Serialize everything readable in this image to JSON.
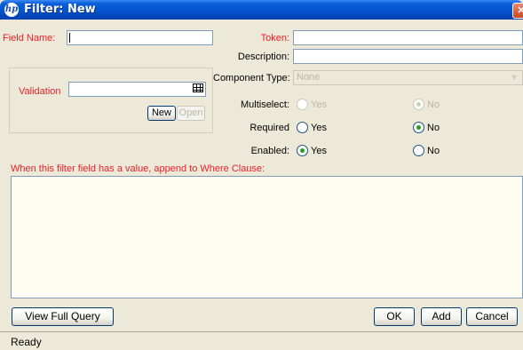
{
  "window": {
    "title": "Filter: New",
    "logo_text": "hp",
    "close_glyph": "✕"
  },
  "form": {
    "field_name_label": "Field Name:",
    "field_name_value": "",
    "token_label": "Token:",
    "token_value": "",
    "description_label": "Description:",
    "description_value": "",
    "component_type_label": "Component Type:",
    "component_type_value": "None",
    "validation_label": "Validation",
    "validation_value": "",
    "new_button": "New",
    "open_button": "Open",
    "multiselect": {
      "label": "Multiselect:",
      "yes": "Yes",
      "no": "No",
      "selected": "No",
      "enabled": false
    },
    "required": {
      "label": "Required",
      "yes": "Yes",
      "no": "No",
      "selected": "No"
    },
    "enabled": {
      "label": "Enabled:",
      "yes": "Yes",
      "no": "No",
      "selected": "Yes"
    },
    "where_clause_label": "When this filter field has a value, append to Where Clause:",
    "where_clause_value": ""
  },
  "buttons": {
    "view_full_query": "View Full Query",
    "ok": "OK",
    "add": "Add",
    "cancel": "Cancel"
  },
  "status": {
    "text": "Ready"
  },
  "colors": {
    "required_label": "#e8202a",
    "window_bg": "#ece9d8",
    "titlebar": "#0454d0",
    "textarea_bg": "#fffdf1"
  },
  "icons": {
    "logo": "hp-logo-icon",
    "close": "close-icon",
    "lookup": "lookup-grid-icon",
    "combo": "chevron-down-icon"
  }
}
